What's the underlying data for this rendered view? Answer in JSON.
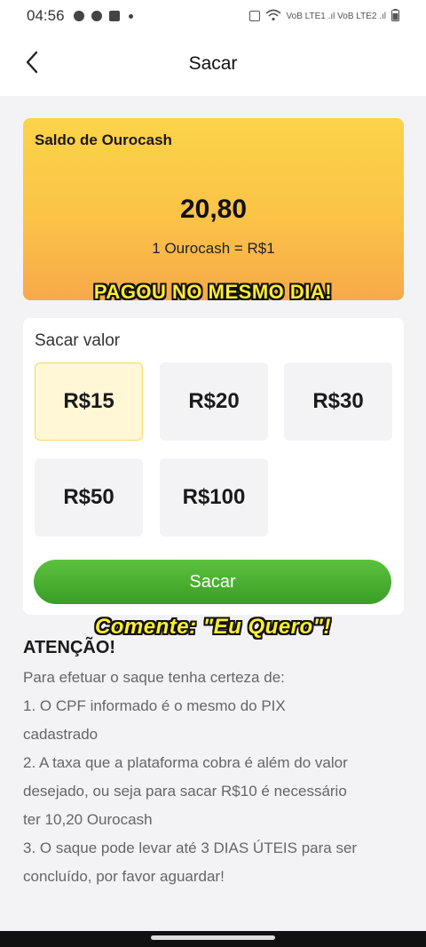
{
  "status_bar": {
    "time": "04:56",
    "right_text": "VoB LTE1 .ıl VoB LTE2 .ıl"
  },
  "header": {
    "title": "Sacar",
    "back_icon": "chevron-left-icon"
  },
  "balance": {
    "label": "Saldo de Ourocash",
    "value": "20,80",
    "rate": "1 Ourocash = R$1"
  },
  "overlays": {
    "top": "PAGOU NO MESMO DIA!",
    "bottom": "Comente: \"Eu Quero\"!"
  },
  "withdraw": {
    "label": "Sacar valor",
    "amounts": [
      "R$15",
      "R$20",
      "R$30",
      "R$50",
      "R$100"
    ],
    "selected": "R$15",
    "submit_label": "Sacar"
  },
  "notice": {
    "title": "ATENÇÃO!",
    "lines": [
      "Para efetuar o saque tenha certeza de:",
      "1. O CPF informado é o mesmo do PIX",
      "cadastrado",
      "2. A taxa que a plataforma cobra é além do valor",
      "desejado, ou seja para sacar R$10 é necessário",
      "ter 10,20 Ourocash",
      "3. O saque pode levar até 3 DIAS ÚTEIS para ser",
      "concluído, por favor aguardar!"
    ]
  },
  "colors": {
    "accent_green": "#3a9e26",
    "card_gold": "#fbc347",
    "overlay_yellow": "#ffee33"
  }
}
